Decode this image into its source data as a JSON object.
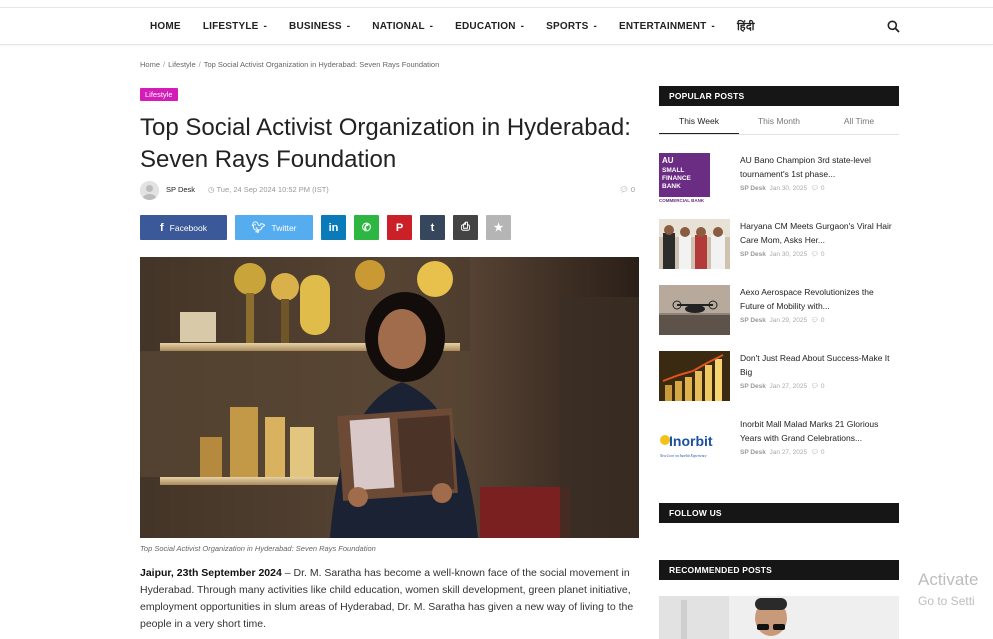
{
  "nav": {
    "items": [
      {
        "label": "HOME",
        "dropdown": false
      },
      {
        "label": "LIFESTYLE",
        "dropdown": true
      },
      {
        "label": "BUSINESS",
        "dropdown": true
      },
      {
        "label": "NATIONAL",
        "dropdown": true
      },
      {
        "label": "EDUCATION",
        "dropdown": true
      },
      {
        "label": "SPORTS",
        "dropdown": true
      },
      {
        "label": "ENTERTAINMENT",
        "dropdown": true
      },
      {
        "label": "हिंदी",
        "dropdown": false
      }
    ],
    "caret": "-",
    "search_icon": "search-icon"
  },
  "breadcrumb": {
    "home": "Home",
    "category": "Lifestyle",
    "current": "Top Social Activist Organization in Hyderabad: Seven Rays Foundation",
    "separator": "/"
  },
  "article": {
    "category": "Lifestyle",
    "category_color": "#d41cb8",
    "title": "Top Social Activist Organization in Hyderabad: Seven Rays Foundation",
    "author": "SP Desk",
    "date": "Tue, 24 Sep 2024 10:52 PM (IST)",
    "comments": "0",
    "share": {
      "facebook": "Facebook",
      "twitter": "Twitter",
      "facebook_color": "#3b5998",
      "twitter_color": "#55acee",
      "icons": [
        {
          "name": "linkedin-icon",
          "glyph": "in",
          "color": "#0a7bb8"
        },
        {
          "name": "whatsapp-icon",
          "glyph": "✆",
          "color": "#2db742"
        },
        {
          "name": "pinterest-icon",
          "glyph": "P",
          "color": "#cb2027"
        },
        {
          "name": "tumblr-icon",
          "glyph": "t",
          "color": "#36465d"
        },
        {
          "name": "print-icon",
          "glyph": "⎙",
          "color": "#444444"
        },
        {
          "name": "star-icon",
          "glyph": "★",
          "color": "#b5b5b5"
        }
      ]
    },
    "image_caption": "Top Social Activist Organization in Hyderabad: Seven Rays Foundation",
    "lead_bold": "Jaipur, 23th September 2024",
    "lead_text": " – Dr. M. Saratha has become a well-known face of the social movement in Hyderabad. Through many activities like child education, women skill development, green planet initiative, employment opportunities in slum areas of Hyderabad, Dr. M. Saratha has given a new way of living to the people in a very short time."
  },
  "sidebar": {
    "popular_title": "POPULAR POSTS",
    "tabs": [
      {
        "label": "This Week",
        "active": true
      },
      {
        "label": "This Month",
        "active": false
      },
      {
        "label": "All Time",
        "active": false
      }
    ],
    "posts": [
      {
        "title": "AU Bano Champion 3rd state-level tournament's 1st phase...",
        "author": "SP Desk",
        "date": "Jan 30, 2025",
        "comments": "0"
      },
      {
        "title": "Haryana CM Meets Gurgaon's Viral Hair Care Mom, Asks Her...",
        "author": "SP Desk",
        "date": "Jan 30, 2025",
        "comments": "0"
      },
      {
        "title": "Aexo Aerospace Revolutionizes the Future of Mobility with...",
        "author": "SP Desk",
        "date": "Jan 29, 2025",
        "comments": "0"
      },
      {
        "title": "Don't Just Read About Success-Make It Big",
        "author": "SP Desk",
        "date": "Jan 27, 2025",
        "comments": "0"
      },
      {
        "title": "Inorbit Mall Malad Marks 21 Glorious Years with Grand Celebrations...",
        "author": "SP Desk",
        "date": "Jan 27, 2025",
        "comments": "0"
      }
    ],
    "thumb_texts": {
      "au_lines": [
        "AU",
        "SMALL",
        "FINANCE",
        "BANK"
      ],
      "au_footer": "COMMERCIAL BANK",
      "inorbit": "Inorbit",
      "inorbit_tag": "New Love on Inorbit Experience"
    },
    "follow_title": "FOLLOW US",
    "recommended_title": "RECOMMENDED POSTS"
  },
  "overlay": {
    "activate": "Activate",
    "activate_sub": "Go to Setti"
  }
}
